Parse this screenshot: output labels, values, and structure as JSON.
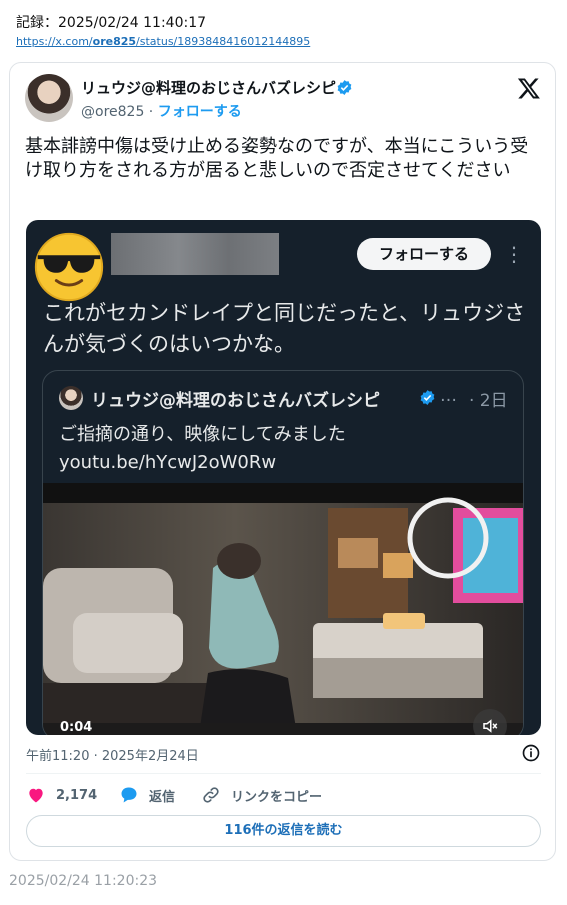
{
  "record": {
    "label": "記録：2025/02/24 11:40:17"
  },
  "source": {
    "url_prefix": "https://x.com/",
    "url_user": "ore825",
    "url_suffix": "/status/1893848416012144895"
  },
  "tweet": {
    "display_name": "リュウジ@料理のおじさんバズレシピ",
    "handle": "@ore825",
    "separator": " · ",
    "follow_label": "フォローする",
    "text": "基本誹謗中傷は受け止める姿勢なのですが、本当にこういう受け取り方をされる方が居ると悲しいので否定させてください",
    "timestamp": "午前11:20 · 2025年2月24日",
    "likes": "2,174",
    "reply_label": "返信",
    "copy_link_label": "リンクをコピー",
    "read_replies_label": "116件の返信を読む"
  },
  "media": {
    "follow_label": "フォローする",
    "more_icon": "more-vertical-icon",
    "text": "これがセカンドレイプと同じだったと、リュウジさんが気づくのはいつかな。",
    "video_time": "0:04",
    "quote": {
      "display_name": "リュウジ@料理のおじさんバズレシピ",
      "ellipsis": "…",
      "time": "· 2日",
      "line1": "ご指摘の通り、映像にしてみました",
      "line2": "youtu.be/hYcwJ2oW0Rw"
    }
  },
  "footer": {
    "time": "2025/02/24 11:20:23"
  },
  "colors": {
    "accent": "#1d9bf0",
    "like": "#f91880",
    "link": "#1d6fb8",
    "media_bg": "#15202b"
  },
  "icons": [
    "x-logo-icon",
    "verified-badge-icon",
    "heart-icon",
    "reply-bubble-icon",
    "link-icon",
    "info-icon",
    "mute-icon",
    "sunglasses-emoji-icon"
  ]
}
